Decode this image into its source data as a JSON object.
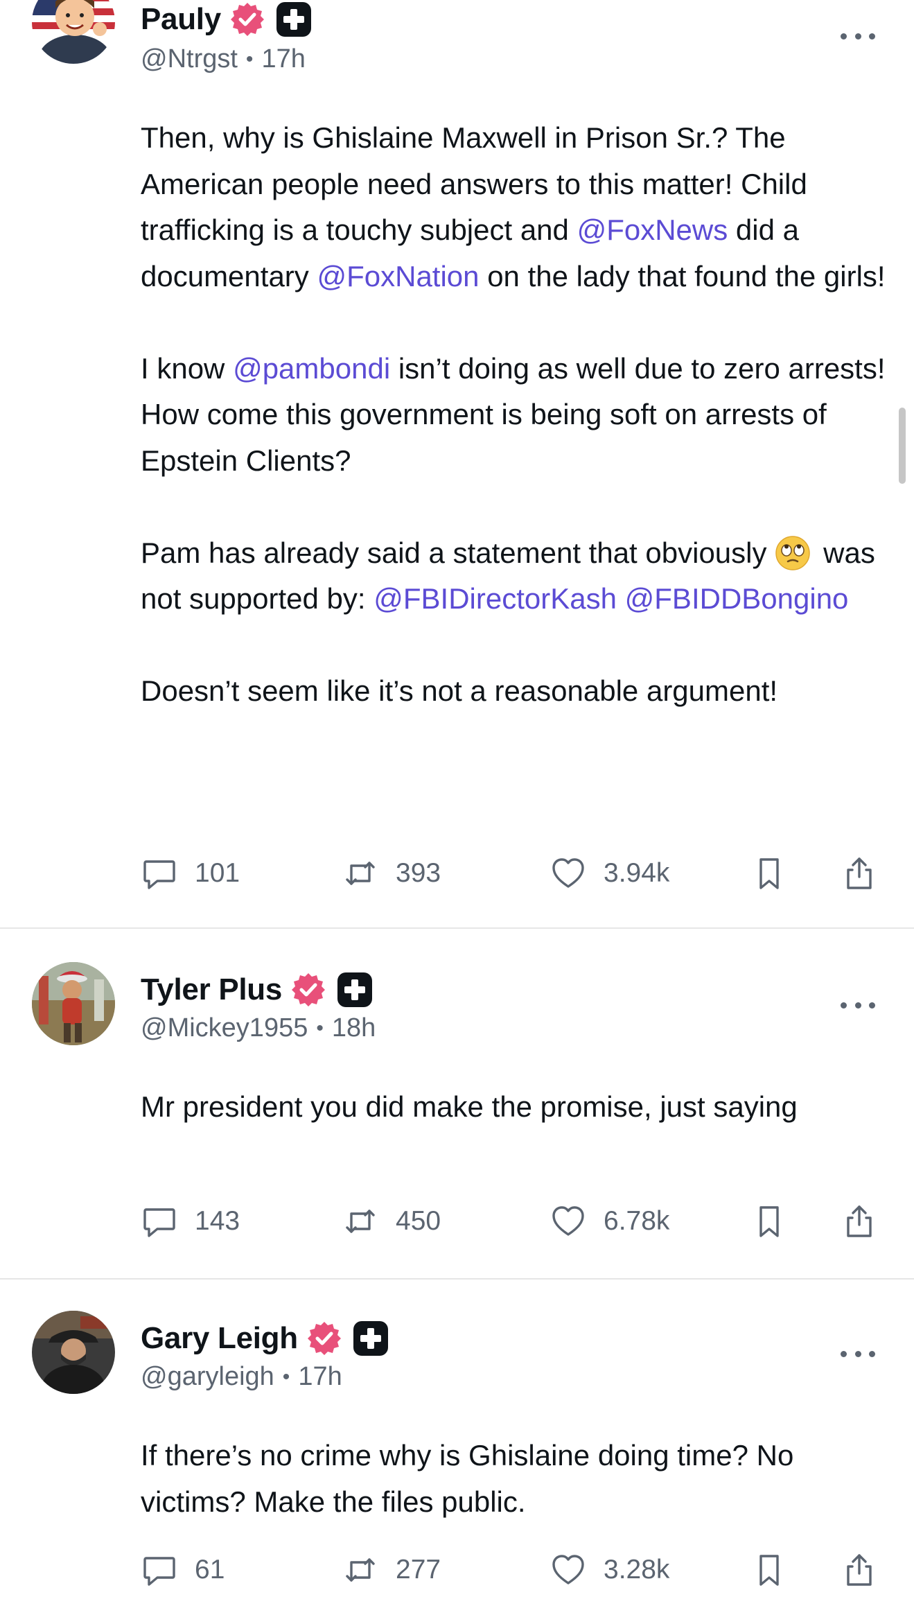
{
  "posts": [
    {
      "name": "Pauly",
      "handle": "@Ntrgst",
      "time": "17h",
      "paragraphs": [
        [
          {
            "t": "Then, why is Ghislaine Maxwell in Prison Sr.? The American people need answers to this matter! Child trafficking is a touchy subject and "
          },
          {
            "t": "@FoxNews",
            "m": true
          },
          {
            "t": " did a documentary "
          },
          {
            "t": "@FoxNation",
            "m": true
          },
          {
            "t": " on the lady that found the girls!"
          }
        ],
        [
          {
            "t": "I know "
          },
          {
            "t": "@pambondi",
            "m": true
          },
          {
            "t": " isn’t doing as well due to zero arrests! How come this government is being soft on arrests of Epstein Clients?"
          }
        ],
        [
          {
            "t": "Pam has already said a statement that obviously "
          },
          {
            "emoji": "face-with-rolling-eyes"
          },
          {
            "t": "was not supported by: "
          },
          {
            "t": "@FBIDirectorKash",
            "m": true
          },
          {
            "t": " "
          },
          {
            "t": "@FBIDDBongino",
            "m": true
          }
        ],
        [
          {
            "t": "Doesn’t seem like it’s not a reasonable argument!"
          }
        ]
      ],
      "replies": "101",
      "reposts": "393",
      "likes": "3.94k"
    },
    {
      "name": "Tyler Plus",
      "handle": "@Mickey1955",
      "time": "18h",
      "paragraphs": [
        [
          {
            "t": "Mr president you did make the promise, just saying"
          }
        ]
      ],
      "replies": "143",
      "reposts": "450",
      "likes": "6.78k"
    },
    {
      "name": "Gary Leigh",
      "handle": "@garyleigh",
      "time": "17h",
      "paragraphs": [
        [
          {
            "t": "If there’s no crime why is Ghislaine doing time? No victims? Make the files public."
          }
        ]
      ],
      "replies": "61",
      "reposts": "277",
      "likes": "3.28k"
    }
  ],
  "icons": {
    "verified": "verified-badge-icon",
    "plus": "plus-badge-icon",
    "more": "more-horizontal-icon",
    "reply": "comment-bubble-icon",
    "repost": "repost-arrows-icon",
    "like": "heart-icon",
    "save": "bookmark-icon",
    "share": "share-upload-icon"
  },
  "colors": {
    "mention": "#5b4bd4",
    "verified": "#e8507a",
    "secondary_text": "#5b6470",
    "divider": "#e6e6e6"
  }
}
